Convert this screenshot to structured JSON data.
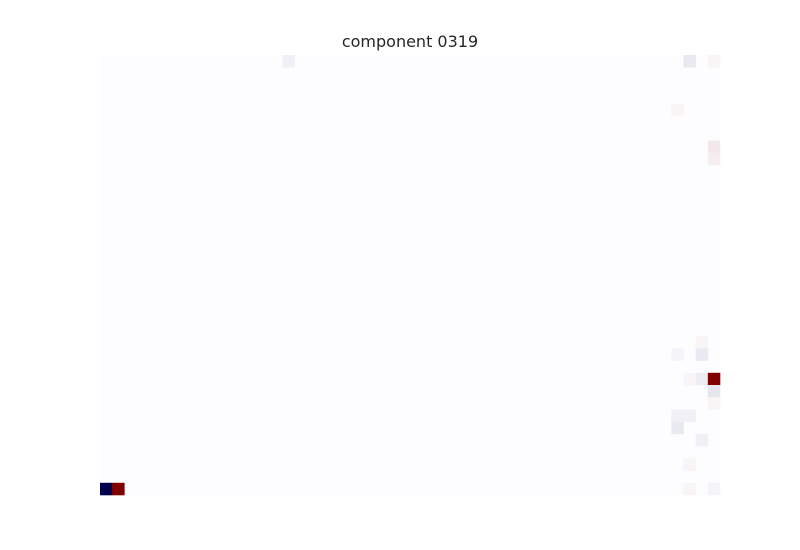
{
  "chart_data": {
    "type": "heatmap",
    "title": "component 0319",
    "xlabel": "",
    "ylabel": "",
    "grid": false,
    "colormap": "seismic",
    "vmin": -1,
    "vmax": 1,
    "colors": {
      "negative": "#00004c",
      "zero": "#fdfdff",
      "positive": "#800000"
    },
    "n_rows": 36,
    "n_cols": 51,
    "default_value": 0,
    "cells": [
      {
        "row": 0,
        "col": 15,
        "value": -0.03
      },
      {
        "row": 0,
        "col": 48,
        "value": -0.05
      },
      {
        "row": 0,
        "col": 50,
        "value": 0.02
      },
      {
        "row": 4,
        "col": 47,
        "value": 0.02
      },
      {
        "row": 7,
        "col": 50,
        "value": 0.05
      },
      {
        "row": 8,
        "col": 50,
        "value": 0.04
      },
      {
        "row": 23,
        "col": 49,
        "value": 0.02
      },
      {
        "row": 24,
        "col": 47,
        "value": -0.02
      },
      {
        "row": 24,
        "col": 49,
        "value": -0.05
      },
      {
        "row": 26,
        "col": 48,
        "value": 0.02
      },
      {
        "row": 26,
        "col": 49,
        "value": -0.04
      },
      {
        "row": 26,
        "col": 50,
        "value": 1.0
      },
      {
        "row": 27,
        "col": 50,
        "value": -0.06
      },
      {
        "row": 28,
        "col": 50,
        "value": 0.02
      },
      {
        "row": 29,
        "col": 47,
        "value": -0.03
      },
      {
        "row": 29,
        "col": 48,
        "value": -0.03
      },
      {
        "row": 30,
        "col": 47,
        "value": -0.05
      },
      {
        "row": 31,
        "col": 49,
        "value": -0.03
      },
      {
        "row": 33,
        "col": 48,
        "value": 0.02
      },
      {
        "row": 35,
        "col": 0,
        "value": -1.0
      },
      {
        "row": 35,
        "col": 1,
        "value": 1.0
      },
      {
        "row": 35,
        "col": 48,
        "value": 0.02
      },
      {
        "row": 35,
        "col": 50,
        "value": -0.02
      }
    ]
  }
}
